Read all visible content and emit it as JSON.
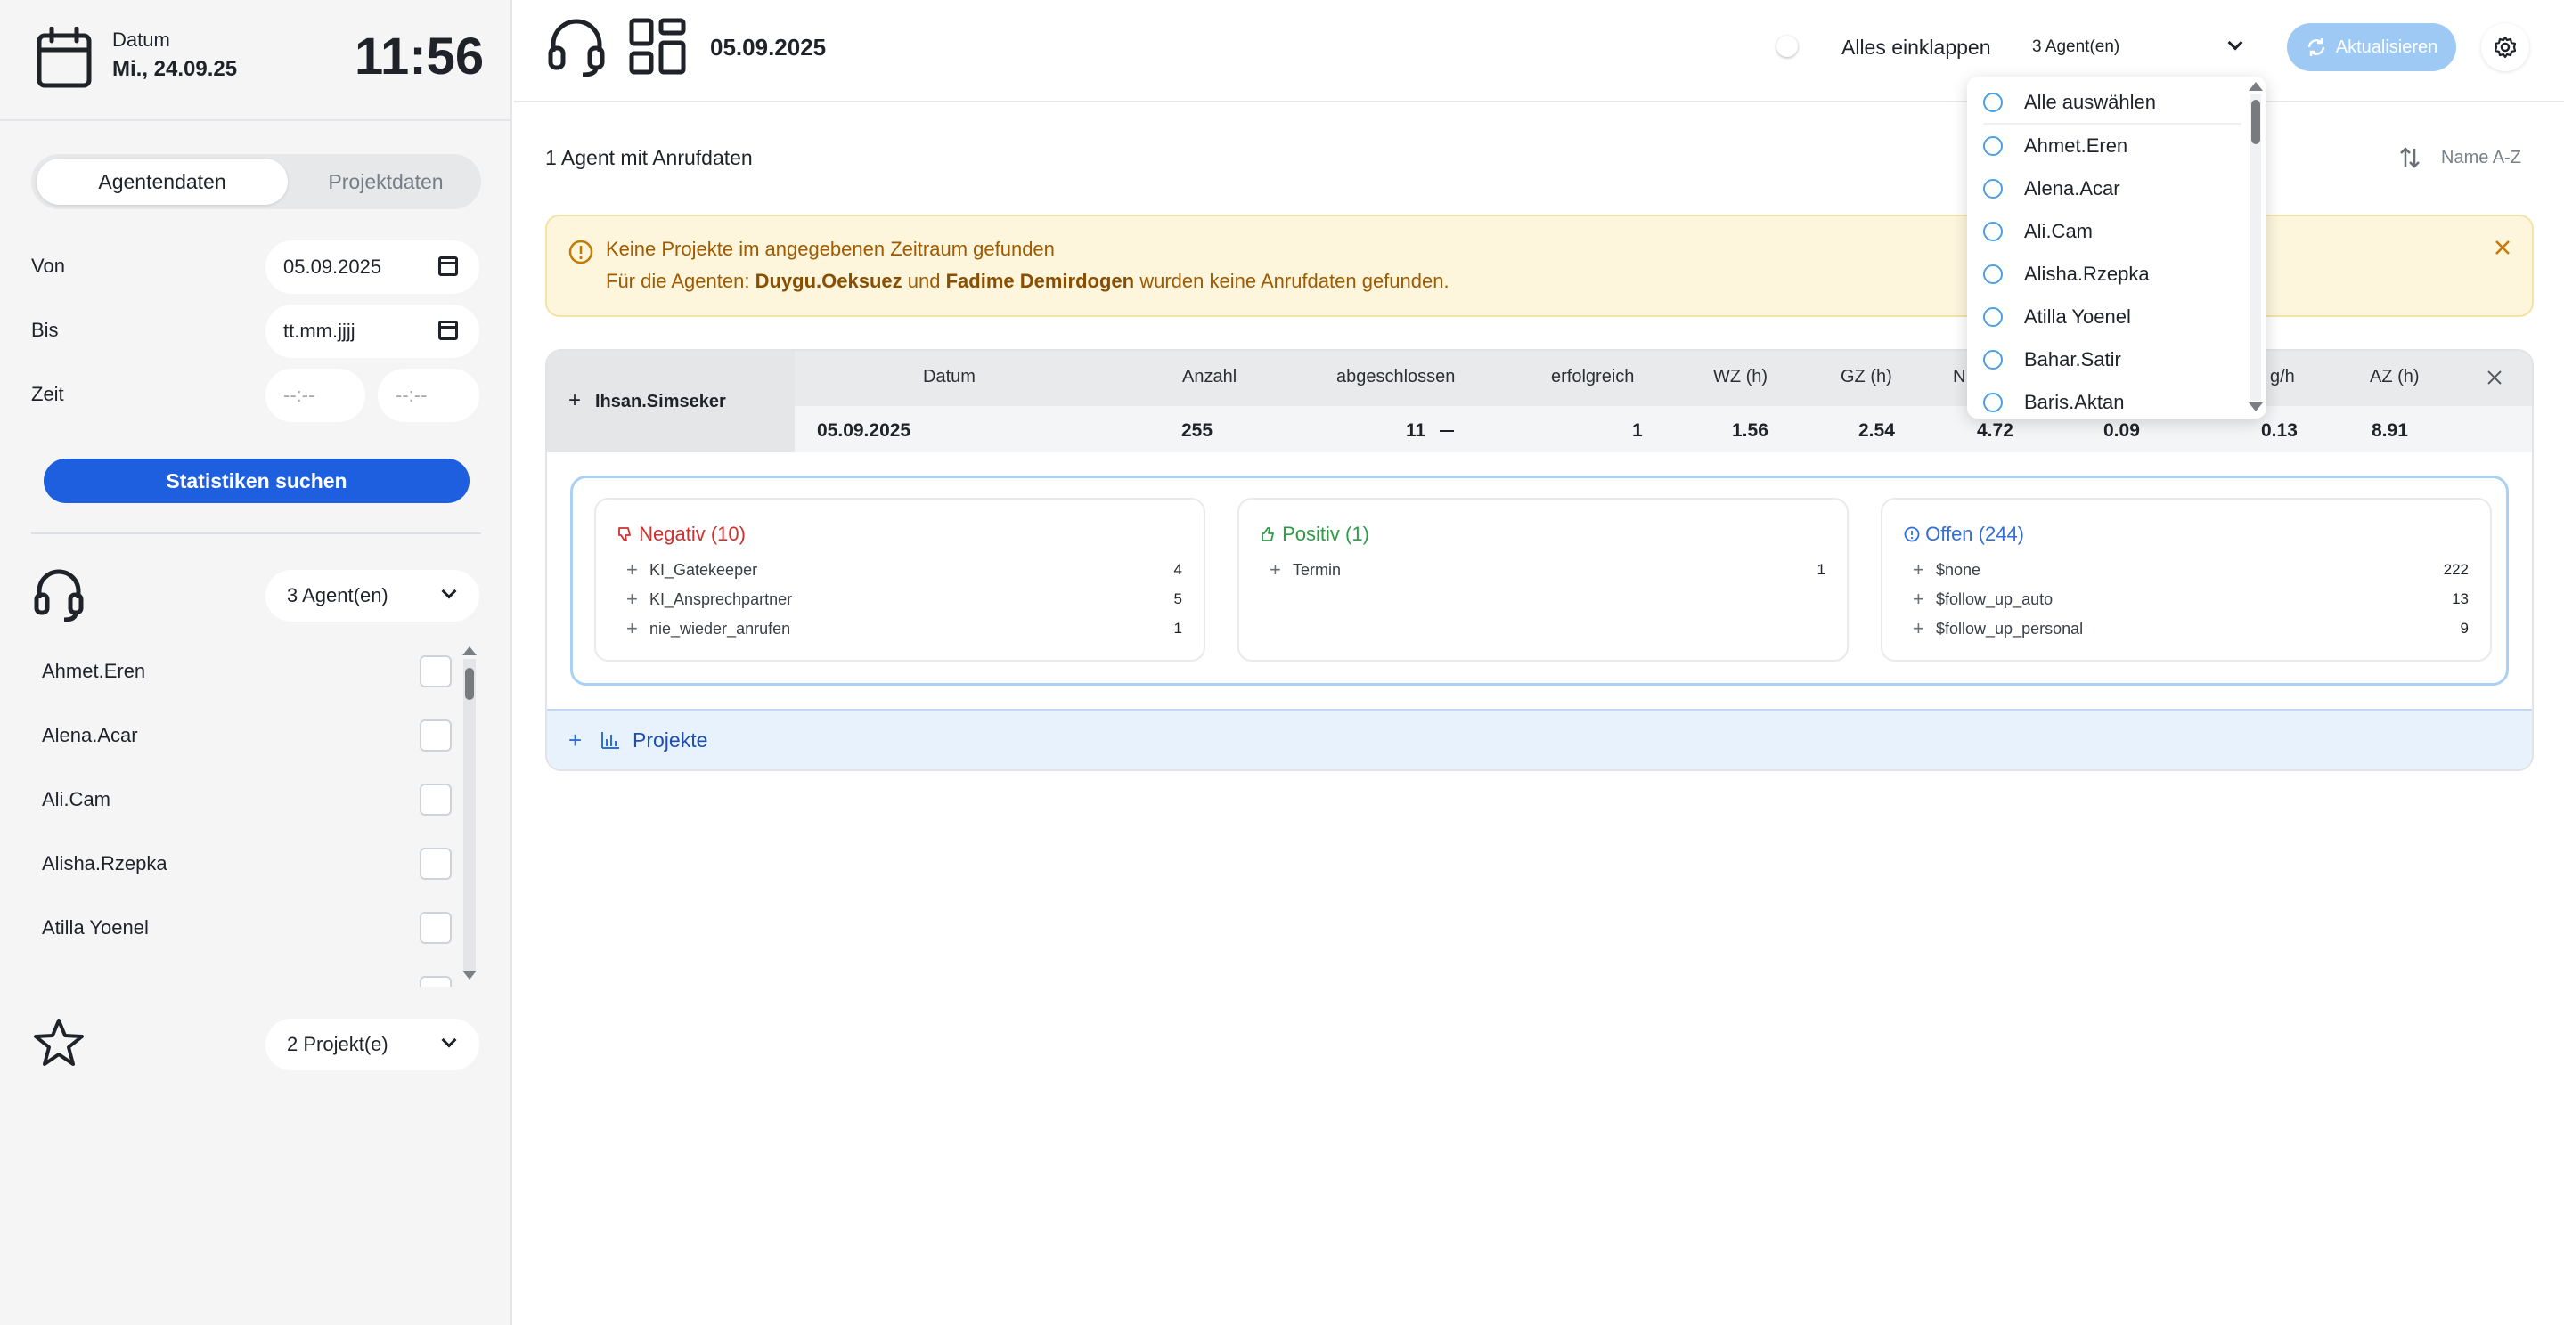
{
  "sidebar": {
    "date_label": "Datum",
    "date_value": "Mi., 24.09.25",
    "clock": "11:56",
    "tabs": [
      "Agentendaten",
      "Projektdaten"
    ],
    "from_label": "Von",
    "from_value": "05.09.2025",
    "to_label": "Bis",
    "to_placeholder": "tt.mm.jjjj",
    "time_label": "Zeit",
    "time_from_placeholder": "--:--",
    "time_to_placeholder": "--:--",
    "search_button": "Statistiken suchen",
    "agents_select": "3 Agent(en)",
    "agent_list": [
      "Ahmet.Eren",
      "Alena.Acar",
      "Ali.Cam",
      "Alisha.Rzepka",
      "Atilla Yoenel"
    ],
    "projects_select": "2 Projekt(e)"
  },
  "header": {
    "date": "05.09.2025",
    "collapse_all": "Alles einklappen",
    "agents_select": "3 Agent(en)",
    "refresh": "Aktualisieren"
  },
  "main": {
    "agent_count": "1 Agent mit Anrufdaten",
    "sort_label": "Name A-Z",
    "alert": {
      "title": "Keine Projekte im angegebenen Zeitraum gefunden",
      "prefix": "Für die Agenten:",
      "agent1": "Duygu.Oeksuez",
      "and": "und",
      "agent2": "Fadime Demirdogen",
      "suffix": "wurden keine Anrufdaten gefunden."
    },
    "table": {
      "agent_name": "Ihsan.Simseker",
      "headers": [
        "Datum",
        "Anzahl",
        "abgeschlossen",
        "erfolgreich",
        "WZ (h)",
        "GZ (h)",
        "N",
        "g/h",
        "AZ (h)"
      ],
      "row": {
        "datum": "05.09.2025",
        "anzahl": "255",
        "abgeschlossen": "11",
        "erfolgreich": "1",
        "wz": "1.56",
        "gz": "2.54",
        "n": "4.72",
        "c8": "0.09",
        "gh": "0.13",
        "az": "8.91"
      }
    },
    "negativ": {
      "title": "Negativ (10)",
      "items": [
        {
          "label": "KI_Gatekeeper",
          "value": "4"
        },
        {
          "label": "KI_Ansprechpartner",
          "value": "5"
        },
        {
          "label": "nie_wieder_anrufen",
          "value": "1"
        }
      ]
    },
    "positiv": {
      "title": "Positiv (1)",
      "items": [
        {
          "label": "Termin",
          "value": "1"
        }
      ]
    },
    "offen": {
      "title": "Offen (244)",
      "items": [
        {
          "label": "$none",
          "value": "222"
        },
        {
          "label": "$follow_up_auto",
          "value": "13"
        },
        {
          "label": "$follow_up_personal",
          "value": "9"
        }
      ]
    },
    "projects_label": "Projekte"
  },
  "agents_dropdown": {
    "items": [
      "Alle auswählen",
      "Ahmet.Eren",
      "Alena.Acar",
      "Ali.Cam",
      "Alisha.Rzepka",
      "Atilla Yoenel",
      "Bahar.Satir",
      "Baris.Aktan"
    ]
  },
  "colors": {
    "primary": "#1e5fe0",
    "negativ": "#d32f2f",
    "positiv": "#2e9c46",
    "offen": "#2f6fd6",
    "alert_text": "#a05a00"
  }
}
